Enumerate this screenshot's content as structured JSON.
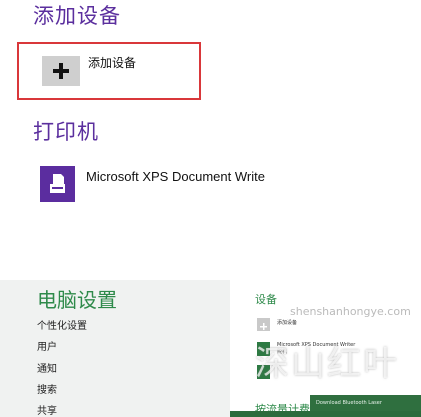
{
  "devices_panel": {
    "add_section_title": "添加设备",
    "add_device_label": "添加设备",
    "printers_section_title": "打印机",
    "printer_name": "Microsoft XPS Document Write"
  },
  "pc_settings": {
    "title": "电脑设置",
    "nav": [
      "个性化设置",
      "用户",
      "通知",
      "搜索",
      "共享"
    ]
  },
  "right_pane": {
    "title": "设备",
    "add_device": "添加设备",
    "devices": [
      {
        "name": "Microsoft XPS Document Writer",
        "sub": "脱机"
      },
      {
        "name": "",
        "sub": ""
      }
    ],
    "second_section": "按流量计费",
    "context_text": "Download Bluetooth Laser"
  },
  "watermark": {
    "site": "shenshanhongye.com",
    "glyphs": "深山红叶"
  },
  "colors": {
    "purple": "#5b2d9f",
    "green_title": "#2e8a4a",
    "red_highlight": "#d9373a",
    "pane_bg": "#f0f2f1"
  },
  "icons": {
    "add": "plus-icon",
    "printer": "printer-icon"
  }
}
